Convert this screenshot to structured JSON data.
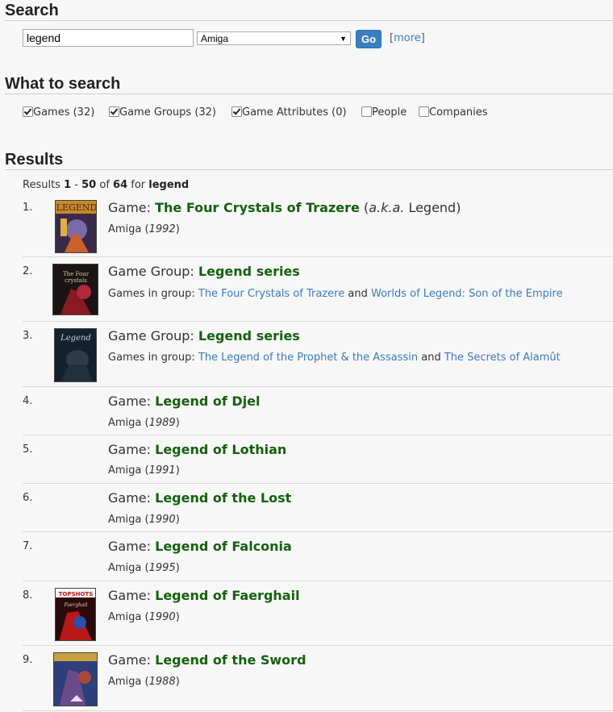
{
  "search": {
    "heading": "Search",
    "query": "legend",
    "platform": "Amiga",
    "go_label": "Go",
    "more_label": "more"
  },
  "what_to_search": {
    "heading": "What to search",
    "options": [
      {
        "label": "Games (32)",
        "checked": true
      },
      {
        "label": "Game Groups (32)",
        "checked": true
      },
      {
        "label": "Game Attributes (0)",
        "checked": true
      },
      {
        "label": "People",
        "checked": false
      },
      {
        "label": "Companies",
        "checked": false
      }
    ]
  },
  "results": {
    "heading": "Results",
    "summary": {
      "prefix": "Results",
      "from": "1",
      "dash": "-",
      "to": "50",
      "of": "of",
      "total": "64",
      "for": "for",
      "term": "legend"
    },
    "items": [
      {
        "num": "1.",
        "type": "Game:",
        "name": "The Four Crystals of Trazere",
        "aka_open": "(",
        "aka_label": "a.k.a.",
        "aka_name": "Legend)",
        "platform": "Amiga",
        "year": "1992"
      },
      {
        "num": "2.",
        "type": "Game Group:",
        "name": "Legend series",
        "group_label": "Games in group:",
        "game_a": "The Four Crystals of Trazere",
        "and": "and",
        "game_b": "Worlds of Legend: Son of the Empire"
      },
      {
        "num": "3.",
        "type": "Game Group:",
        "name": "Legend series",
        "group_label": "Games in group:",
        "game_a": "The Legend of the Prophet & the Assassin",
        "and": "and",
        "game_b": "The Secrets of Alamût"
      },
      {
        "num": "4.",
        "type": "Game:",
        "name": "Legend of Djel",
        "platform": "Amiga",
        "year": "1989"
      },
      {
        "num": "5.",
        "type": "Game:",
        "name": "Legend of Lothian",
        "platform": "Amiga",
        "year": "1991"
      },
      {
        "num": "6.",
        "type": "Game:",
        "name": "Legend of the Lost",
        "platform": "Amiga",
        "year": "1990"
      },
      {
        "num": "7.",
        "type": "Game:",
        "name": "Legend of Falconia",
        "platform": "Amiga",
        "year": "1995"
      },
      {
        "num": "8.",
        "type": "Game:",
        "name": "Legend of Faerghail",
        "platform": "Amiga",
        "year": "1990"
      },
      {
        "num": "9.",
        "type": "Game:",
        "name": "Legend of the Sword",
        "platform": "Amiga",
        "year": "1988"
      }
    ]
  },
  "colors": {
    "title_green": "#16600f",
    "link_blue": "#3d7ab6",
    "go_blue": "#3a7ebf"
  }
}
